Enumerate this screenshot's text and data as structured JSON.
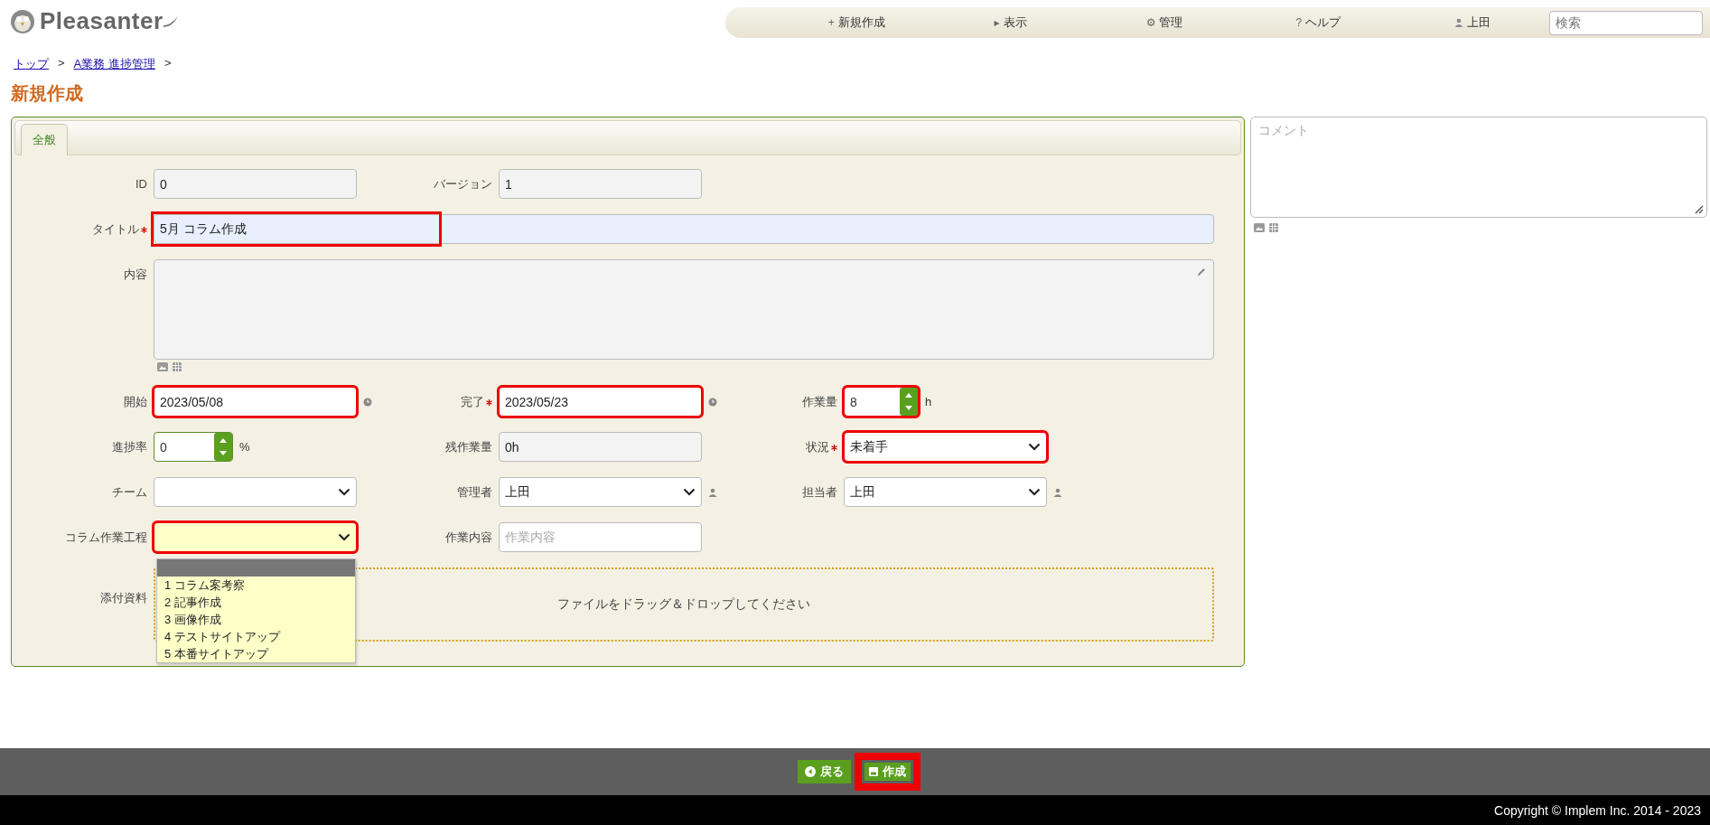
{
  "header": {
    "logo": "Pleasanter",
    "nav": [
      {
        "kind": "menu",
        "glyph": "+",
        "label": "新規作成"
      },
      {
        "kind": "menu",
        "glyph": "▸",
        "label": "表示"
      },
      {
        "kind": "menu",
        "glyph": "⚙",
        "label": "管理"
      },
      {
        "kind": "menu",
        "glyph": "?",
        "label": "ヘルプ"
      },
      {
        "kind": "user",
        "label": "上田"
      }
    ],
    "search": {
      "placeholder": "検索"
    }
  },
  "breadcrumb": {
    "separator": ">",
    "items": [
      {
        "label": "トップ"
      },
      {
        "label": "A業務 進捗管理"
      }
    ]
  },
  "page_title": "新規作成",
  "tabs": [
    {
      "label": "全般",
      "selected": true
    }
  ],
  "form": {
    "rows": [
      {
        "fields": [
          {
            "kind": "text",
            "label": "ID",
            "required": false,
            "value": "0",
            "readonly": true,
            "highlighted": false
          },
          {
            "kind": "text",
            "label": "バージョン",
            "required": false,
            "value": "1",
            "readonly": true,
            "highlighted": false
          }
        ]
      },
      {
        "fields": [
          {
            "kind": "wide",
            "label": "タイトル",
            "required": true,
            "value": "5月 コラム作成",
            "highlighted": true
          }
        ]
      },
      {
        "fields": [
          {
            "kind": "textarea",
            "label": "内容",
            "required": false,
            "highlighted": false
          }
        ]
      },
      {
        "fields": [
          {
            "kind": "date",
            "label": "開始",
            "required": false,
            "value": "2023/05/08",
            "highlighted": true
          },
          {
            "kind": "date",
            "label": "完了",
            "required": true,
            "value": "2023/05/23",
            "highlighted": true
          },
          {
            "kind": "number",
            "label": "作業量",
            "required": false,
            "value": "8",
            "unit": "h",
            "highlighted": true
          }
        ]
      },
      {
        "fields": [
          {
            "kind": "number",
            "label": "進捗率",
            "required": false,
            "value": "0",
            "unit": "%",
            "highlighted": false
          },
          {
            "kind": "text",
            "label": "残作業量",
            "required": false,
            "value": "0h",
            "readonly": true,
            "highlighted": false
          },
          {
            "kind": "select",
            "label": "状況",
            "required": true,
            "value": "未着手",
            "open": false,
            "highlighted": true
          }
        ]
      },
      {
        "fields": [
          {
            "kind": "select",
            "label": "チーム",
            "required": false,
            "open": false,
            "highlighted": false
          },
          {
            "kind": "user",
            "label": "管理者",
            "required": false,
            "value": "上田",
            "highlighted": false
          },
          {
            "kind": "user",
            "label": "担当者",
            "required": false,
            "value": "上田",
            "highlighted": false
          }
        ]
      },
      {
        "fields": [
          {
            "kind": "select",
            "label": "コラム作業工程",
            "required": false,
            "open": true,
            "blank_highlighted": true,
            "options": [
              "1 コラム案考察",
              "2 記事作成",
              "3 画像作成",
              "4 テストサイトアップ",
              "5 本番サイトアップ"
            ],
            "highlighted": true
          },
          {
            "kind": "text",
            "label": "作業内容",
            "required": false,
            "placeholder": "作業内容",
            "readonly": false,
            "highlighted": false
          }
        ]
      },
      {
        "fields": [
          {
            "kind": "dropzone",
            "label": "添付資料",
            "required": false,
            "text": "ファイルをドラッグ＆ドロップしてください",
            "highlighted": false
          }
        ]
      }
    ]
  },
  "comment": {
    "placeholder": "コメント"
  },
  "footer": {
    "buttons": [
      {
        "kind": "back",
        "label": "戻る",
        "highlighted": false
      },
      {
        "kind": "create",
        "label": "作成",
        "highlighted": true
      }
    ],
    "copyright": "Copyright © Implem Inc. 2014 - 2023"
  }
}
